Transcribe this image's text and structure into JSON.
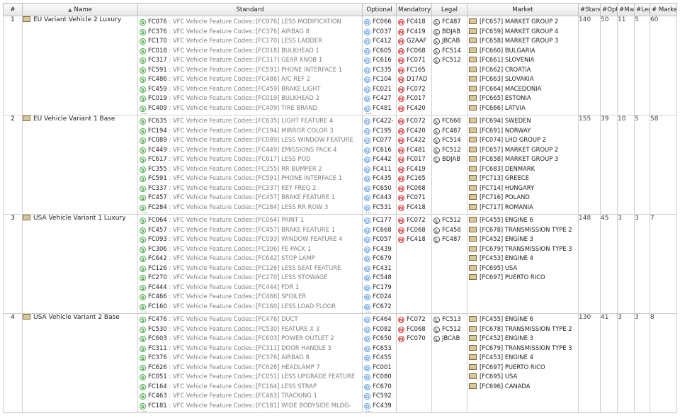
{
  "headers": {
    "idx": "#",
    "sort_indicator": "▲",
    "name": "Name",
    "standard": "Standard",
    "optional": "Optional",
    "mandatory": "Mandatory",
    "legal": "Legal",
    "market": "Market",
    "n_standard": "#Stand",
    "n_optional": "#Opti",
    "n_mandatory": "#Man",
    "n_legal": "#Leg",
    "n_market": "# Market"
  },
  "icons": {
    "standard": "S",
    "optional": "O",
    "mandatory": "M",
    "legal": "L",
    "more": "..."
  },
  "colors": {
    "standard_icon": "#2a8f2a",
    "optional_icon": "#5a9be0",
    "mandatory_icon": "#d43838",
    "legal_icon": "#444444",
    "grid_border": "#d0d0d0"
  },
  "rows": [
    {
      "idx": "1",
      "name": "EU Variant Vehicle 2 Luxury",
      "standard": [
        {
          "code": "FC076",
          "desc": "VFC Vehicle Feature Codes::[FC076] LESS MODIFICATION"
        },
        {
          "code": "FC376",
          "desc": "VFC Vehicle Feature Codes::[FC376] AIRBAG 8"
        },
        {
          "code": "FC170",
          "desc": "VFC Vehicle Feature Codes::[FC170] LESS LADDER"
        },
        {
          "code": "FC018",
          "desc": "VFC Vehicle Feature Codes::[FC018] BULKHEAD 1"
        },
        {
          "code": "FC317",
          "desc": "VFC Vehicle Feature Codes::[FC317] GEAR KNOB 1"
        },
        {
          "code": "FC591",
          "desc": "VFC Vehicle Feature Codes::[FC591] PHONE INTERFACE 1"
        },
        {
          "code": "FC486",
          "desc": "VFC Vehicle Feature Codes::[FC486] A/C REF 2"
        },
        {
          "code": "FC459",
          "desc": "VFC Vehicle Feature Codes::[FC459] BRAKE LIGHT"
        },
        {
          "code": "FC019",
          "desc": "VFC Vehicle Feature Codes::[FC019] BULKHEAD 2"
        },
        {
          "code": "FC409",
          "desc": "VFC Vehicle Feature Codes::[FC409] TIRE BRAND"
        }
      ],
      "optional": [
        "FC066",
        "FC037",
        "FC412",
        "FC605",
        "FC616",
        "FC335",
        "FC104",
        "FC021",
        "FC427",
        "FC481"
      ],
      "mandatory": [
        "FC418",
        "FC419",
        "G2AAF",
        "FC068",
        "FC071",
        "FC165",
        "D17AD",
        "FC072",
        "FC017",
        "FC420"
      ],
      "legal": [
        "FC487",
        "BDJAB",
        "JBCAB",
        "FC514",
        "FC512"
      ],
      "market": [
        "[FC657] MARKET GROUP 2",
        "[FC659] MARKET GROUP 4",
        "[FC658] MARKET GROUP 3",
        "[FC660] BULGARIA",
        "[FC661] SLOVENIA",
        "[FC662] CROATIA",
        "[FC663] SLOVAKIA",
        "[FC664] MACEDONIA",
        "[FC665] ESTONIA",
        "[FC666] LATVIA"
      ],
      "n_standard": "140",
      "n_optional": "50",
      "n_mandatory": "11",
      "n_legal": "5",
      "n_market": "60"
    },
    {
      "idx": "2",
      "name": "EU Vehicle Variant 1 Base",
      "standard": [
        {
          "code": "FC635",
          "desc": "VFC Vehicle Feature Codes::[FC635] LIGHT FEATURE 4"
        },
        {
          "code": "FC194",
          "desc": "VFC Vehicle Feature Codes::[FC194] MIRROR COLOR 3"
        },
        {
          "code": "FC089",
          "desc": "VFC Vehicle Feature Codes::[FC089] LESS WINDOW FEATURE"
        },
        {
          "code": "FC449",
          "desc": "VFC Vehicle Feature Codes::[FC449] EMISSIONS PACK 4"
        },
        {
          "code": "FC617",
          "desc": "VFC Vehicle Feature Codes::[FC617] LESS POD"
        },
        {
          "code": "FC355",
          "desc": "VFC Vehicle Feature Codes::[FC355] RR BUMPER 2"
        },
        {
          "code": "FC591",
          "desc": "VFC Vehicle Feature Codes::[FC591] PHONE INTERFACE 1"
        },
        {
          "code": "FC337",
          "desc": "VFC Vehicle Feature Codes::[FC337] KEY FREQ 2"
        },
        {
          "code": "FC457",
          "desc": "VFC Vehicle Feature Codes::[FC457] BRAKE FEATURE 1"
        },
        {
          "code": "FC284",
          "desc": "VFC Vehicle Feature Codes::[FC284] LESS RR ROW 3"
        }
      ],
      "optional": [
        "FC422-",
        "FC195",
        "FC077",
        "FC616",
        "FC442",
        "FC411",
        "FC435",
        "FC650",
        "FC443",
        "FC531"
      ],
      "mandatory": [
        "FC072",
        "FC420",
        "FC422",
        "FC481",
        "FC017",
        "FC419",
        "FC165",
        "FC068",
        "FC071",
        "FC418"
      ],
      "legal": [
        "FC668",
        "FC487",
        "FC514",
        "FC512",
        "BDJAB"
      ],
      "market": [
        "[FC694] SWEDEN",
        "[FC691] NORWAY",
        "[FC074] LHD GROUP 2",
        "[FC657] MARKET GROUP 2",
        "[FC658] MARKET GROUP 3",
        "[FC683] DENMARK",
        "[FC713] GREECE",
        "[FC714] HUNGARY",
        "[FC716] POLAND",
        "[FC717] ROMANIA"
      ],
      "n_standard": "155",
      "n_optional": "39",
      "n_mandatory": "10",
      "n_legal": "5",
      "n_market": "58"
    },
    {
      "idx": "3",
      "name": "USA Vehicle Variant 1 Luxury",
      "standard": [
        {
          "code": "FC064",
          "desc": "VFC Vehicle Feature Codes::[FC064] PAINT 1"
        },
        {
          "code": "FC457",
          "desc": "VFC Vehicle Feature Codes::[FC457] BRAKE FEATURE 1"
        },
        {
          "code": "FC093",
          "desc": "VFC Vehicle Feature Codes::[FC093] WINDOW FEATURE 4"
        },
        {
          "code": "FC306",
          "desc": "VFC Vehicle Feature Codes::[FC306] FE PACK 1"
        },
        {
          "code": "FC642",
          "desc": "VFC Vehicle Feature Codes::[FC642] STOP LAMP"
        },
        {
          "code": "FC126",
          "desc": "VFC Vehicle Feature Codes::[FC126] LESS SEAT FEATURE"
        },
        {
          "code": "FC270",
          "desc": "VFC Vehicle Feature Codes::[FC270] LESS STOWAGE"
        },
        {
          "code": "FC444",
          "desc": "VFC Vehicle Feature Codes::[FC444] FDR 1"
        },
        {
          "code": "FC466",
          "desc": "VFC Vehicle Feature Codes::[FC466] SPOILER"
        },
        {
          "code": "FC160",
          "desc": "VFC Vehicle Feature Codes::[FC160] LESS LOAD FLOOR"
        }
      ],
      "optional": [
        "FC177",
        "FC668",
        "FC057",
        "FC439",
        "FC679",
        "FC431",
        "FC548",
        "FC179",
        "FC024",
        "FC672"
      ],
      "mandatory": [
        "FC072",
        "FC068",
        "FC418"
      ],
      "legal": [
        "FC512",
        "FC458",
        "FC487"
      ],
      "market": [
        "[FC455] ENGINE 6",
        "[FC678] TRANSMISSION TYPE 2",
        "[FC452] ENGINE 3",
        "[FC679] TRANSMISSION TYPE 3",
        "[FC453] ENGINE 4",
        "[FC695] USA",
        "[FC697] PUERTO RICO"
      ],
      "n_standard": "148",
      "n_optional": "45",
      "n_mandatory": "3",
      "n_legal": "3",
      "n_market": "7"
    },
    {
      "idx": "4",
      "name": "USA Vehicle Variant 2 Base",
      "standard": [
        {
          "code": "FC476",
          "desc": "VFC Vehicle Feature Codes::[FC476] DUCT"
        },
        {
          "code": "FC530",
          "desc": "VFC Vehicle Feature Codes::[FC530] FEATURE X 3"
        },
        {
          "code": "FC603",
          "desc": "VFC Vehicle Feature Codes::[FC603] POWER OUTLET 2"
        },
        {
          "code": "FC311",
          "desc": "VFC Vehicle Feature Codes::[FC311] DOOR HANDLE 3"
        },
        {
          "code": "FC376",
          "desc": "VFC Vehicle Feature Codes::[FC376] AIRBAG 8"
        },
        {
          "code": "FC626",
          "desc": "VFC Vehicle Feature Codes::[FC626] HEADLAMP 7"
        },
        {
          "code": "FC051",
          "desc": "VFC Vehicle Feature Codes::[FC051] LESS UPGRADE FEATURE"
        },
        {
          "code": "FC164",
          "desc": "VFC Vehicle Feature Codes::[FC164] LESS STRAP"
        },
        {
          "code": "FC463",
          "desc": "VFC Vehicle Feature Codes::[FC463] TRACKING 1"
        },
        {
          "code": "FC181",
          "desc": "VFC Vehicle Feature Codes::[FC181] WIDE BODYSIDE MLDG-"
        }
      ],
      "optional": [
        "FC464",
        "FC082",
        "FC650",
        "FC653",
        "FC455",
        "FC001",
        "FC080",
        "FC670",
        "FC592",
        "FC439"
      ],
      "mandatory": [
        "FC072",
        "FC068",
        "FC070"
      ],
      "legal": [
        "FC513",
        "FC512",
        "JBCAB"
      ],
      "market": [
        "[FC455] ENGINE 6",
        "[FC678] TRANSMISSION TYPE 2",
        "[FC452] ENGINE 3",
        "[FC679] TRANSMISSION TYPE 3",
        "[FC453] ENGINE 4",
        "[FC697] PUERTO RICO",
        "[FC695] USA",
        "[FC696] CANADA"
      ],
      "n_standard": "130",
      "n_optional": "41",
      "n_mandatory": "3",
      "n_legal": "3",
      "n_market": "8"
    }
  ]
}
